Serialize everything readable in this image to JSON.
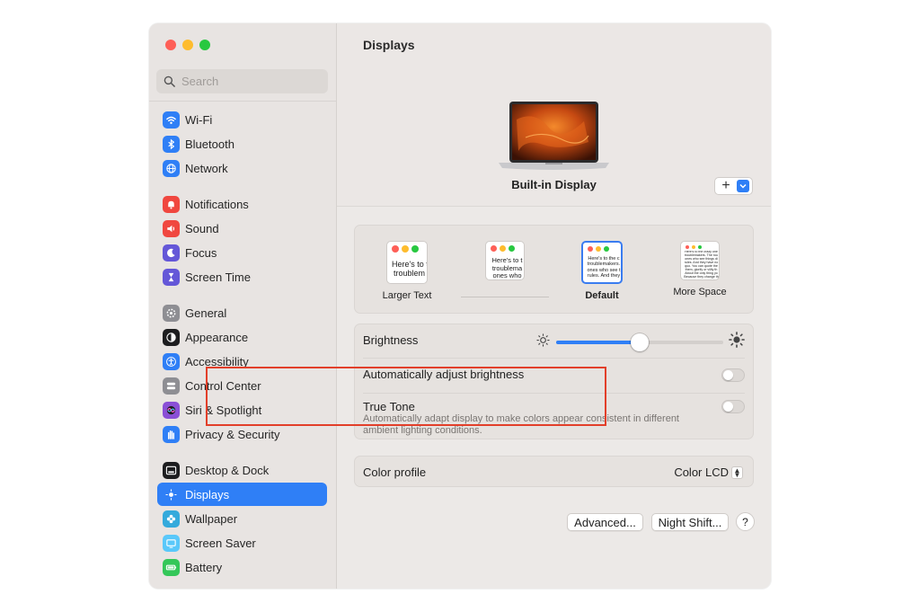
{
  "window": {
    "title": "Displays"
  },
  "search": {
    "placeholder": "Search"
  },
  "sidebar": {
    "items": [
      {
        "label": "Wi-Fi",
        "icon": "wifi-icon",
        "color": "#2f7ff6"
      },
      {
        "label": "Bluetooth",
        "icon": "bluetooth-icon",
        "color": "#2f7ff6"
      },
      {
        "label": "Network",
        "icon": "globe-icon",
        "color": "#2f7ff6"
      },
      {
        "label": "Notifications",
        "icon": "bell-icon",
        "color": "#f0473f"
      },
      {
        "label": "Sound",
        "icon": "speaker-icon",
        "color": "#f0473f"
      },
      {
        "label": "Focus",
        "icon": "moon-icon",
        "color": "#6457d8"
      },
      {
        "label": "Screen Time",
        "icon": "hourglass-icon",
        "color": "#6457d8"
      },
      {
        "label": "General",
        "icon": "gear-icon",
        "color": "#8e8e93"
      },
      {
        "label": "Appearance",
        "icon": "appearance-icon",
        "color": "#1d1d1f"
      },
      {
        "label": "Accessibility",
        "icon": "accessibility-icon",
        "color": "#2f7ff6"
      },
      {
        "label": "Control Center",
        "icon": "control-center-icon",
        "color": "#8e8e93"
      },
      {
        "label": "Siri & Spotlight",
        "icon": "siri-icon",
        "color": "#8a4fd6"
      },
      {
        "label": "Privacy & Security",
        "icon": "hand-icon",
        "color": "#2f7ff6"
      },
      {
        "label": "Desktop & Dock",
        "icon": "dock-icon",
        "color": "#1d1d1f"
      },
      {
        "label": "Displays",
        "icon": "sun-icon",
        "color": "#2f7ff6"
      },
      {
        "label": "Wallpaper",
        "icon": "flower-icon",
        "color": "#34aadc"
      },
      {
        "label": "Screen Saver",
        "icon": "screensaver-icon",
        "color": "#5ac8fa"
      },
      {
        "label": "Battery",
        "icon": "battery-icon",
        "color": "#34c759"
      }
    ],
    "selected": "Displays"
  },
  "main": {
    "title": "Displays",
    "display_name": "Built-in Display",
    "add_button": "+",
    "resolutions": [
      {
        "label": "Larger Text",
        "sample": "Here's to t\ntroublem"
      },
      {
        "label": "",
        "sample": "Here's to t\ntroublema\nones who"
      },
      {
        "label": "Default",
        "sample": "Here's to the c\ntroublemakers.\nones who see t\nrules. And they"
      },
      {
        "label": "More Space",
        "sample": "Here's to the crazy one\ntroublemakers. The rou\nones who see things di\nrules. And they have no\nquo. You can quote the\nthem, glorify or vilify th\nAbout the only thing yo\nBecause they change th"
      }
    ],
    "selected_resolution": "Default",
    "brightness": {
      "label": "Brightness",
      "level": 0.5
    },
    "auto_brightness": {
      "label": "Automatically adjust brightness",
      "on": false
    },
    "true_tone": {
      "label": "True Tone",
      "description": "Automatically adapt display to make colors appear consistent in different ambient lighting conditions.",
      "on": false
    },
    "color_profile": {
      "label": "Color profile",
      "value": "Color LCD"
    },
    "buttons": {
      "advanced": "Advanced...",
      "night_shift": "Night Shift...",
      "help": "?"
    }
  },
  "colors": {
    "accent": "#2f7ff6",
    "highlight_box": "#e23f2a"
  }
}
